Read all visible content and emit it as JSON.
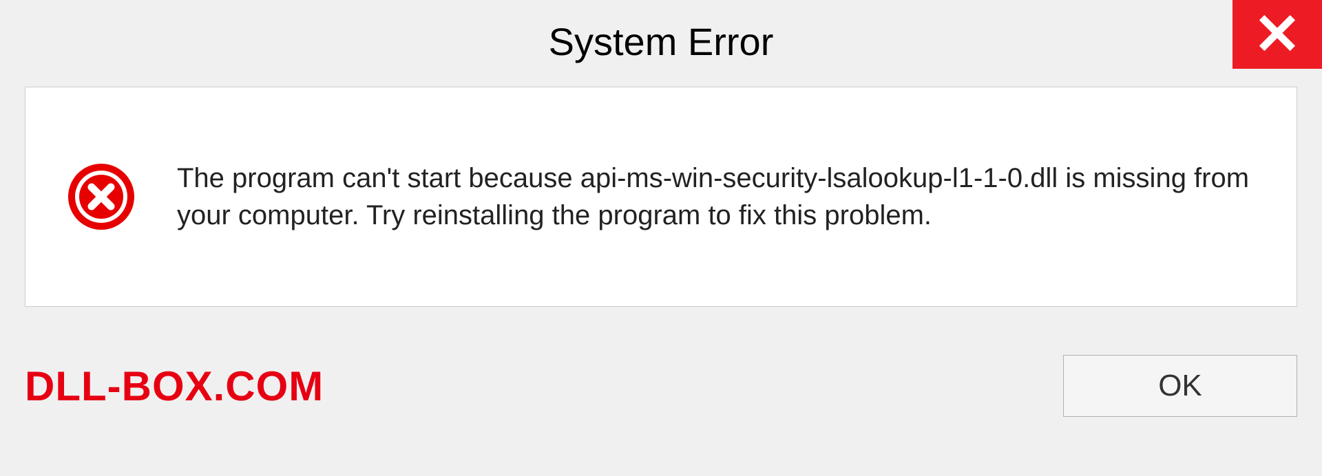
{
  "dialog": {
    "title": "System Error",
    "message": "The program can't start because api-ms-win-security-lsalookup-l1-1-0.dll is missing from your computer. Try reinstalling the program to fix this problem.",
    "ok_label": "OK"
  },
  "watermark": {
    "text": "DLL-BOX.COM"
  },
  "colors": {
    "close_bg": "#ed1c24",
    "error_icon": "#e60000",
    "watermark": "#e60012"
  }
}
